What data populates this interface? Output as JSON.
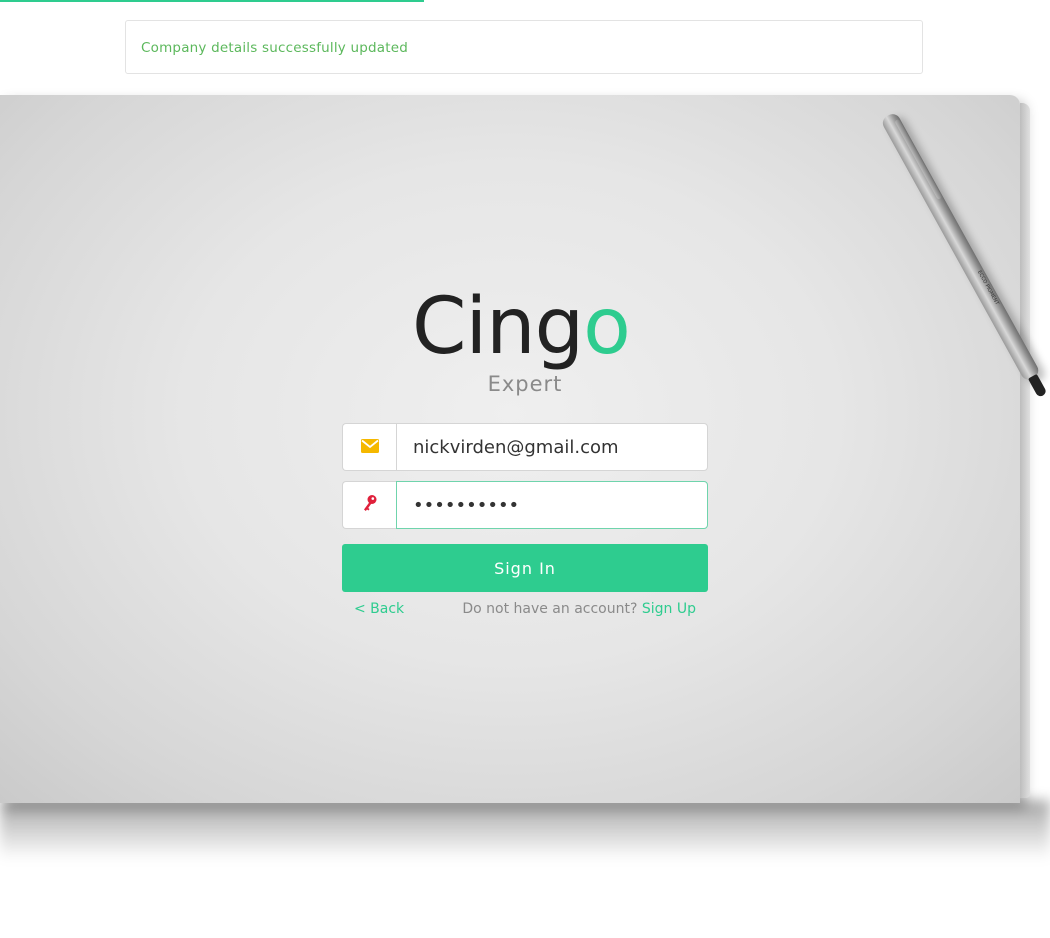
{
  "alert": {
    "message": "Company details successfully updated"
  },
  "brand": {
    "logo_main": "Cing",
    "logo_accent": "o",
    "subtitle": "Expert",
    "accent_color": "#2ecc8f"
  },
  "form": {
    "email": {
      "value": "nickvirden@gmail.com",
      "icon": "envelope-icon"
    },
    "password": {
      "value": "••••••••••",
      "icon": "key-icon"
    },
    "signin_label": "Sign In"
  },
  "links": {
    "back_label": "< Back",
    "no_account_text": "Do not have an account?",
    "signup_label": "Sign Up"
  },
  "decor": {
    "pen_text": "ECCO PIGMENT"
  },
  "progress": {
    "fraction": 0.4
  }
}
